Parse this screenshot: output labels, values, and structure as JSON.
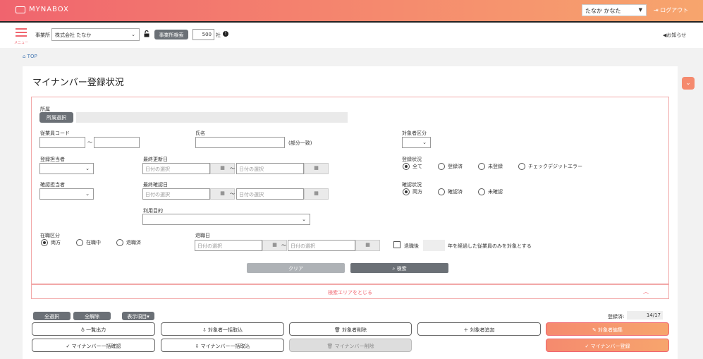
{
  "app": {
    "name": "MYNABOX"
  },
  "user": {
    "name": "たなか かなた",
    "logout": "ログアウト"
  },
  "header": {
    "menu_label": "メニュー",
    "office_label": "事業所",
    "office_value": "株式会社 たなか",
    "office_search": "事業所検索",
    "count": "500",
    "count_unit": "社",
    "notice": "お知らせ"
  },
  "breadcrumb": "TOP",
  "page": {
    "title": "マイナンバー登録状況"
  },
  "form": {
    "dept_label": "所属",
    "dept_button": "所属選択",
    "empcode_label": "従業員コード",
    "tilde": "〜",
    "name_label": "氏名",
    "name_hint": "(部分一致)",
    "target_label": "対象者区分",
    "reg_person_label": "登録担当者",
    "last_update_label": "最終更新日",
    "date_placeholder": "日付の選択",
    "reg_status_label": "登録状況",
    "reg_status_options": [
      "全て",
      "登録済",
      "未登録",
      "チェックデジットエラー"
    ],
    "confirm_person_label": "確認担当者",
    "last_confirm_label": "最終確認日",
    "confirm_status_label": "確認状況",
    "confirm_status_options": [
      "両方",
      "確認済",
      "未確認"
    ],
    "purpose_label": "利用目的",
    "employment_label": "在職区分",
    "employment_options": [
      "両方",
      "在職中",
      "退職済"
    ],
    "retire_date_label": "退職日",
    "retire_after_label": "退職後",
    "retire_after_suffix": "年を経過した従業員のみを対象とする",
    "clear": "クリア",
    "search": "検索"
  },
  "toggle_search": "検索エリアをとじる",
  "list": {
    "select_all": "全選択",
    "deselect_all": "全解除",
    "display_items": "表示項目",
    "registered_label": "登録済:",
    "registered_value": "14/17"
  },
  "actions": {
    "export": "一覧出力",
    "import_targets": "対象者一括取込",
    "delete_target": "対象者削除",
    "add_target": "対象者追加",
    "edit_target": "対象者編集",
    "bulk_confirm": "マイナンバー一括確認",
    "bulk_import_mn": "マイナンバー一括取込",
    "delete_mn": "マイナンバー削除",
    "register_mn": "マイナンバー登録"
  }
}
